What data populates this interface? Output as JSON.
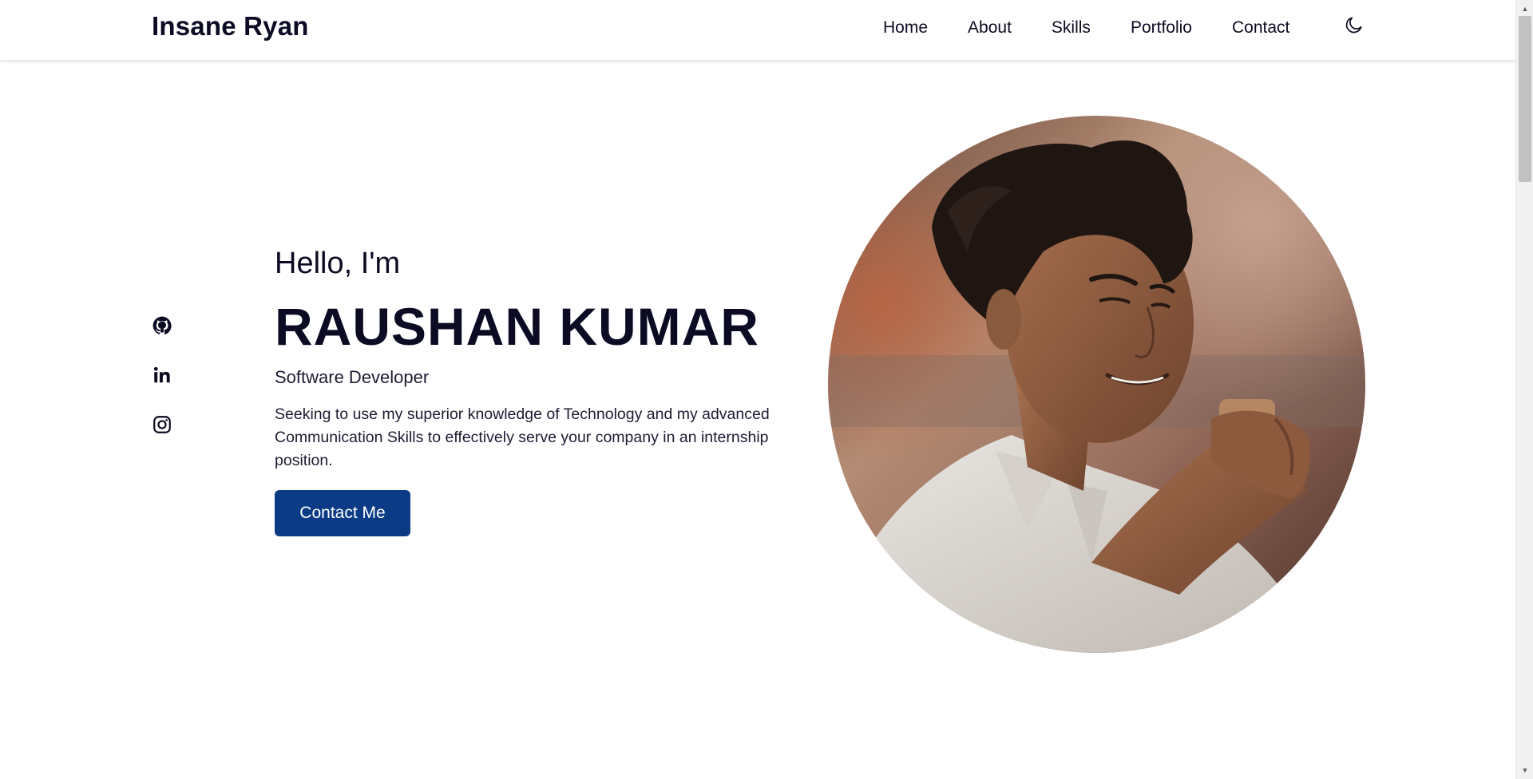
{
  "header": {
    "brand": "Insane Ryan",
    "nav": [
      {
        "label": "Home"
      },
      {
        "label": "About"
      },
      {
        "label": "Skills"
      },
      {
        "label": "Portfolio"
      },
      {
        "label": "Contact"
      }
    ],
    "theme_toggle_icon": "moon-icon"
  },
  "social": [
    {
      "icon": "github-icon"
    },
    {
      "icon": "linkedin-icon"
    },
    {
      "icon": "instagram-icon"
    }
  ],
  "hero": {
    "greeting": "Hello, I'm",
    "name": "RAUSHAN KUMAR",
    "role": "Software Developer",
    "description": "Seeking to use my superior knowledge of Technology and my advanced Communication Skills to effectively serve your company in an internship position.",
    "cta_label": "Contact Me"
  },
  "colors": {
    "text": "#0b0b23",
    "accent": "#0b3b85",
    "background": "#ffffff"
  }
}
